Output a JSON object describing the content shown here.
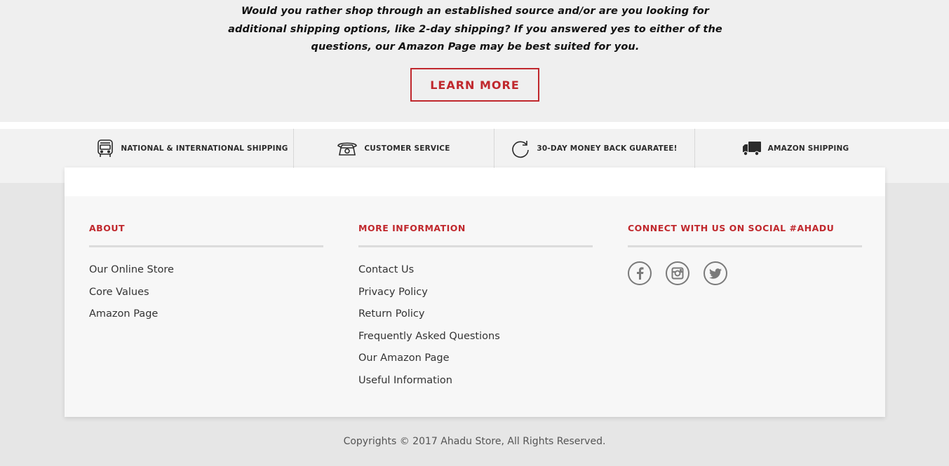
{
  "promo": {
    "text": "Would you rather shop through an established source and/or are you looking for additional shipping options, like 2-day shipping? If you answered yes to either of the questions, our Amazon Page may be best suited for you.",
    "button_label": "LEARN MORE"
  },
  "features": [
    {
      "label": "NATIONAL & INTERNATIONAL SHIPPING",
      "icon": "bus-icon"
    },
    {
      "label": "CUSTOMER SERVICE",
      "icon": "telephone-icon"
    },
    {
      "label": "30-DAY MONEY BACK GUARATEE!",
      "icon": "refresh-icon"
    },
    {
      "label": "AMAZON SHIPPING",
      "icon": "truck-icon"
    }
  ],
  "footer": {
    "about": {
      "title": "ABOUT",
      "links": [
        "Our Online Store",
        "Core Values",
        "Amazon Page"
      ]
    },
    "more_info": {
      "title": "MORE INFORMATION",
      "links": [
        "Contact Us",
        "Privacy Policy",
        "Return Policy",
        "Frequently Asked Questions",
        "Our Amazon Page",
        "Useful Information"
      ]
    },
    "social": {
      "title": "CONNECT WITH US ON SOCIAL #AHADU",
      "icons": [
        "facebook-icon",
        "instagram-icon",
        "twitter-icon"
      ]
    }
  },
  "copyright": "Copyrights © 2017 Ahadu Store, All Rights Reserved.",
  "colors": {
    "accent": "#c0282d",
    "promo_bg": "#efefef",
    "page_bg": "#e6e6e6",
    "card_bg": "#f7f7f7"
  }
}
